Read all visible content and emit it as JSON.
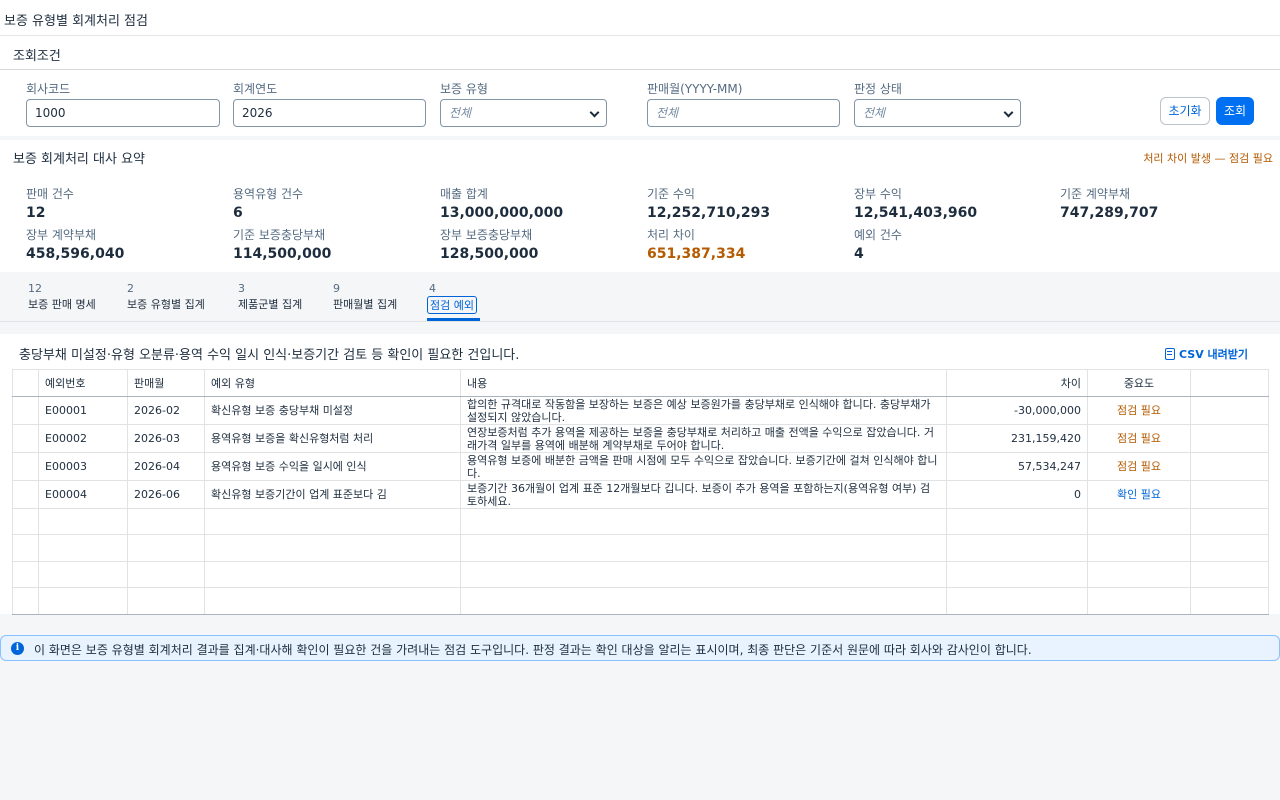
{
  "app": {
    "title": "보증 유형별 회계처리 점검"
  },
  "filters": {
    "section_title": "조회조건",
    "company_code": {
      "label": "회사코드",
      "value": "1000"
    },
    "fiscal_year": {
      "label": "회계연도",
      "value": "2026"
    },
    "warranty_type": {
      "label": "보증 유형",
      "placeholder": "전체"
    },
    "sales_month": {
      "label": "판매월(YYYY-MM)",
      "placeholder": "전체"
    },
    "judgment_status": {
      "label": "판정 상태",
      "placeholder": "전체"
    },
    "reset_label": "초기화",
    "search_label": "조회"
  },
  "summary": {
    "title": "보증 회계처리 대사 요약",
    "alert": "처리 차이 발생 — 점검 필요",
    "kpis": [
      {
        "label": "판매 건수",
        "value": "12"
      },
      {
        "label": "용역유형 건수",
        "value": "6"
      },
      {
        "label": "매출 합계",
        "value": "13,000,000,000"
      },
      {
        "label": "기준 수익",
        "value": "12,252,710,293"
      },
      {
        "label": "장부 수익",
        "value": "12,541,403,960"
      },
      {
        "label": "기준 계약부채",
        "value": "747,289,707"
      },
      {
        "label": "장부 계약부채",
        "value": "458,596,040"
      },
      {
        "label": "기준 보증충당부채",
        "value": "114,500,000"
      },
      {
        "label": "장부 보증충당부채",
        "value": "128,500,000"
      },
      {
        "label": "처리 차이",
        "value": "651,387,334"
      },
      {
        "label": "예외 건수",
        "value": "4"
      }
    ]
  },
  "tabs": [
    {
      "count": "12",
      "label": "보증 판매 명세"
    },
    {
      "count": "2",
      "label": "보증 유형별 집계"
    },
    {
      "count": "3",
      "label": "제품군별 집계"
    },
    {
      "count": "9",
      "label": "판매월별 집계"
    },
    {
      "count": "4",
      "label": "점검 예외"
    }
  ],
  "exceptions": {
    "description": "충당부채 미설정·유형 오분류·용역 수익 일시 인식·보증기간 검토 등 확인이 필요한 건입니다.",
    "csv_label": "CSV 내려받기",
    "columns": [
      "예외번호",
      "판매월",
      "예외 유형",
      "내용",
      "차이",
      "중요도"
    ],
    "rows": [
      {
        "id": "E00001",
        "month": "2026-02",
        "type": "확신유형 보증 충당부채 미설정",
        "content": "합의한 규격대로 작동함을 보장하는 보증은 예상 보증원가를 충당부채로 인식해야 합니다. 충당부채가 설정되지 않았습니다.",
        "diff": "-30,000,000",
        "importance": "점검 필요"
      },
      {
        "id": "E00002",
        "month": "2026-03",
        "type": "용역유형 보증을 확신유형처럼 처리",
        "content": "연장보증처럼 추가 용역을 제공하는 보증을 충당부채로 처리하고 매출 전액을 수익으로 잡았습니다. 거래가격 일부를 용역에 배분해 계약부채로 두어야 합니다.",
        "diff": "231,159,420",
        "importance": "점검 필요"
      },
      {
        "id": "E00003",
        "month": "2026-04",
        "type": "용역유형 보증 수익을 일시에 인식",
        "content": "용역유형 보증에 배분한 금액을 판매 시점에 모두 수익으로 잡았습니다. 보증기간에 걸쳐 인식해야 합니다.",
        "diff": "57,534,247",
        "importance": "점검 필요"
      },
      {
        "id": "E00004",
        "month": "2026-06",
        "type": "확신유형 보증기간이 업계 표준보다 김",
        "content": "보증기간 36개월이 업계 표준 12개월보다 깁니다. 보증이 추가 용역을 포함하는지(용역유형 여부) 검토하세요.",
        "diff": "0",
        "importance": "확인 필요"
      }
    ]
  },
  "info": {
    "icon": "info-icon",
    "text": "이 화면은 보증 유형별 회계처리 결과를 집계·대사해 확인이 필요한 건을 가려내는 점검 도구입니다. 판정 결과는 확인 대상을 알리는 표시이며, 최종 판단은 기준서 원문에 따라 회사와 감사인이 합니다."
  },
  "colors": {
    "accent": "#0070f2",
    "warning": "#b45a00",
    "info_bg": "#e8f3ff"
  }
}
